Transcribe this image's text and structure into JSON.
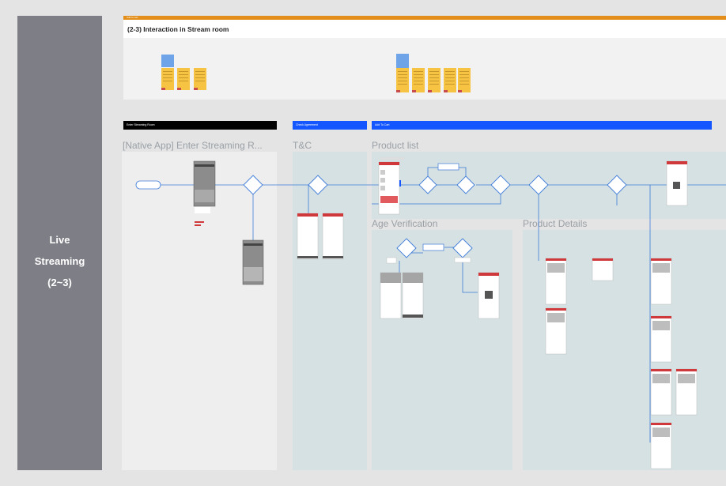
{
  "sidebar": {
    "label_lines": [
      "Live",
      "Streaming",
      "(2~3)"
    ]
  },
  "header": {
    "mini": "Add to cart",
    "title": "(2-3) Interaction in Stream room"
  },
  "sections": {
    "enter": {
      "bar": "Enter Streaming Room",
      "title": "[Native App] Enter Streaming R..."
    },
    "tc": {
      "bar": "Check Agreement",
      "title": "T&C"
    },
    "cart": {
      "bar": "Add To Cart"
    },
    "product_list": {
      "title": "Product list"
    },
    "age": {
      "title": "Age Verification"
    },
    "details": {
      "title": "Product Details"
    }
  },
  "colors": {
    "sidebar": "#7e7f86",
    "header_bar": "#e38e1a",
    "section_blue": "#1456ff",
    "panel": "#d5e1e2",
    "flow": "#3d7bd9",
    "accent": "#d0393b"
  }
}
